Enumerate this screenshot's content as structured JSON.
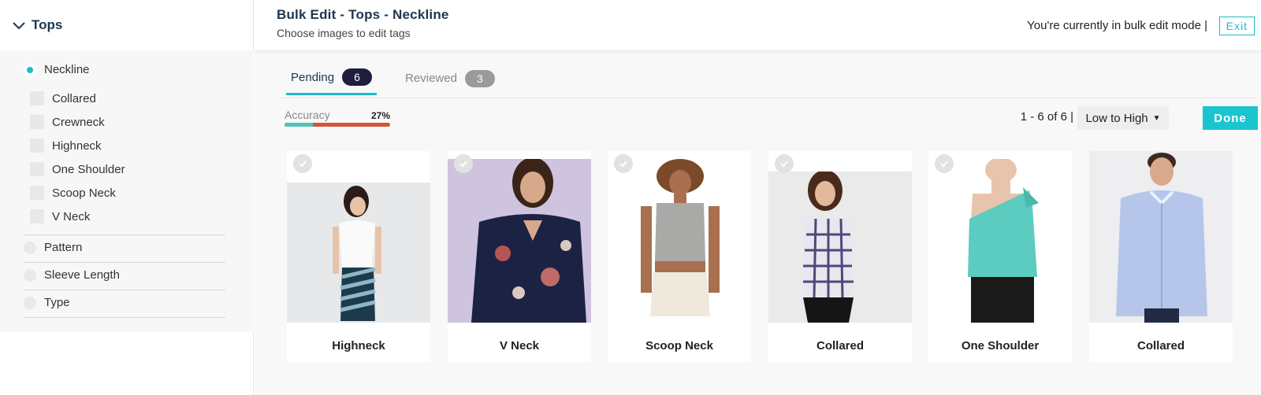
{
  "sidebar": {
    "category": "Tops",
    "attributes": [
      {
        "label": "Neckline",
        "selected": true
      },
      {
        "label": "Pattern",
        "selected": false
      },
      {
        "label": "Sleeve Length",
        "selected": false
      },
      {
        "label": "Type",
        "selected": false
      }
    ],
    "neckline_options": [
      "Collared",
      "Crewneck",
      "Highneck",
      "One Shoulder",
      "Scoop Neck",
      "V Neck"
    ]
  },
  "header": {
    "title": "Bulk Edit - Tops - Neckline",
    "subtitle": "Choose images to edit tags",
    "mode_text": "You're currently in bulk edit mode |",
    "exit_label": "Exit"
  },
  "tabs": [
    {
      "label": "Pending",
      "count": "6",
      "active": true
    },
    {
      "label": "Reviewed",
      "count": "3",
      "active": false
    }
  ],
  "accuracy": {
    "label": "Accuracy",
    "value_text": "27%",
    "fraction": 0.27
  },
  "toolbar": {
    "pager": "1 - 6 of 6 |",
    "sort_label": "Low to High",
    "done_label": "Done"
  },
  "cards": [
    {
      "label": "Highneck",
      "image": "woman-white-top-striped-skirt"
    },
    {
      "label": "V Neck",
      "image": "woman-navy-floral-top"
    },
    {
      "label": "Scoop Neck",
      "image": "woman-grey-crop-tank"
    },
    {
      "label": "Collared",
      "image": "woman-plaid-shirt"
    },
    {
      "label": "One Shoulder",
      "image": "woman-teal-one-shoulder-top"
    },
    {
      "label": "Collared",
      "image": "man-light-blue-oxford-shirt"
    }
  ],
  "colors": {
    "accent": "#1bbccb",
    "title": "#1e3550",
    "count_dark": "#1f1e3d",
    "accuracy_good": "#4dc5b5",
    "accuracy_bad": "#d6523b"
  }
}
